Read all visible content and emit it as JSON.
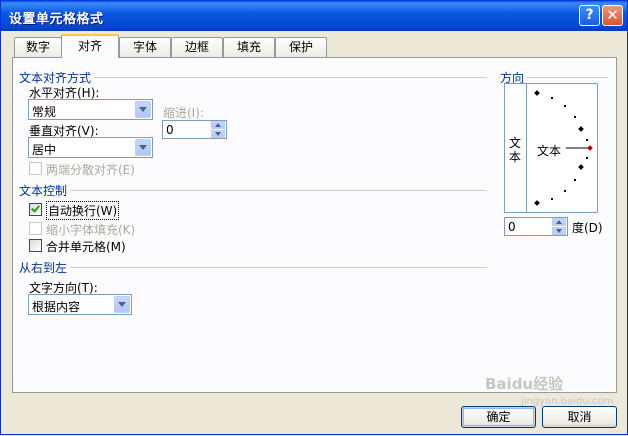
{
  "window": {
    "title": "设置单元格格式"
  },
  "tabs": [
    {
      "label": "数字"
    },
    {
      "label": "对齐"
    },
    {
      "label": "字体"
    },
    {
      "label": "边框"
    },
    {
      "label": "填充"
    },
    {
      "label": "保护"
    }
  ],
  "active_tab": "对齐",
  "text_alignment": {
    "section_title": "文本对齐方式",
    "horizontal_label": "水平对齐(H):",
    "horizontal_value": "常规",
    "indent_label": "缩进(I):",
    "indent_value": "0",
    "vertical_label": "垂直对齐(V):",
    "vertical_value": "居中",
    "distributed_label": "两端分散对齐(E)",
    "distributed_checked": false
  },
  "text_control": {
    "section_title": "文本控制",
    "wrap_label": "自动换行(W)",
    "wrap_checked": true,
    "shrink_label": "缩小字体填充(K)",
    "shrink_checked": false,
    "merge_label": "合并单元格(M)",
    "merge_checked": false
  },
  "rtl": {
    "section_title": "从右到左",
    "direction_label": "文字方向(T):",
    "direction_value": "根据内容"
  },
  "orientation": {
    "section_title": "方向",
    "vertical_text": "文本",
    "text": "文本",
    "degrees_value": "0",
    "degrees_label": "度(D)",
    "indicator_color": "#c00000"
  },
  "buttons": {
    "ok": "确定",
    "cancel": "取消"
  },
  "watermark": {
    "text": "Baidu经验",
    "sub": "jingyan.baidu.com"
  },
  "colors": {
    "title_bar": "#0a58e0",
    "section_title": "#003399",
    "tab_highlight": "#ffc83c"
  }
}
